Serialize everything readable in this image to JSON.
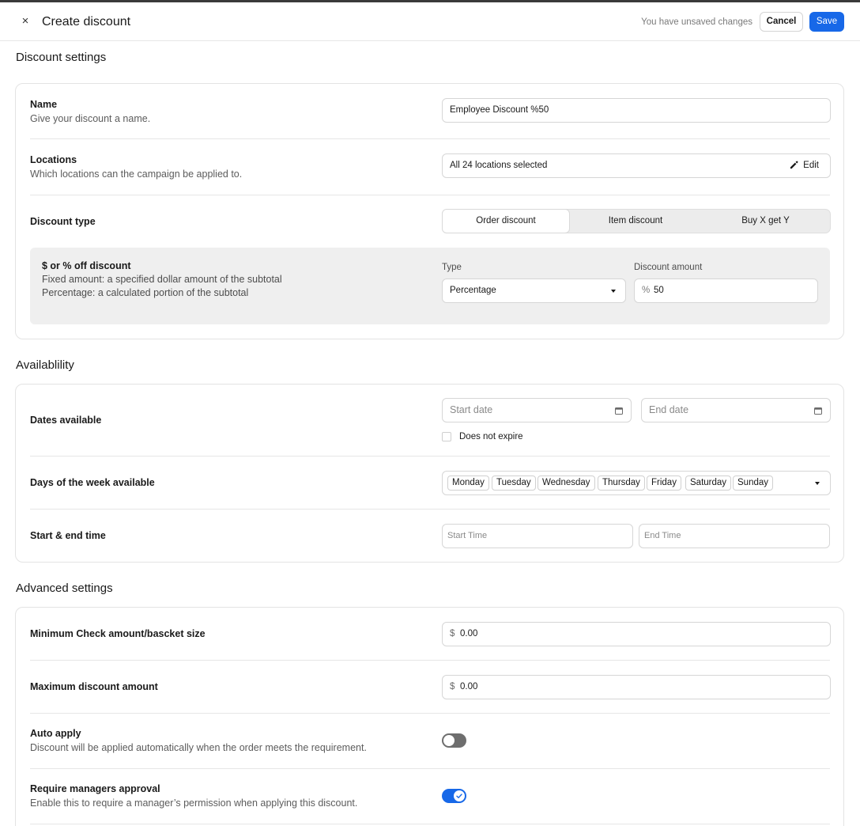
{
  "header": {
    "close_glyph": "×",
    "title": "Create discount",
    "unsaved": "You have unsaved changes",
    "cancel_label": "Cancel",
    "save_label": "Save"
  },
  "colors": {
    "accent": "#1768e8",
    "toggle_off": "#6e6e6e",
    "subpanel_bg": "#efefef"
  },
  "discount_settings": {
    "title": "Discount settings",
    "name": {
      "label": "Name",
      "description": "Give your discount a name.",
      "value": "Employee Discount %50"
    },
    "locations": {
      "label": "Locations",
      "description": "Which locations can the campaign be applied to.",
      "value": "All 24 locations selected",
      "edit_label": "Edit"
    },
    "discount_type": {
      "label": "Discount type",
      "options": [
        "Order discount",
        "Item discount",
        "Buy X get Y"
      ],
      "selected": "Order discount"
    },
    "off_panel": {
      "title": "$ or % off discount",
      "line1": "Fixed amount: a specified dollar amount of the subtotal",
      "line2": "Percentage: a calculated portion of the subtotal",
      "type_label": "Type",
      "type_value": "Percentage",
      "amount_label": "Discount amount",
      "amount_prefix": "%",
      "amount_value": "50"
    }
  },
  "availability": {
    "title": "Availablility",
    "dates": {
      "label": "Dates available",
      "start_placeholder": "Start date",
      "end_placeholder": "End date",
      "no_expire_label": "Does not expire",
      "no_expire_checked": false
    },
    "days": {
      "label": "Days of the week available",
      "selected": [
        "Monday",
        "Tuesday",
        "Wednesday",
        "Thursday",
        "Friday",
        "Saturday",
        "Sunday"
      ]
    },
    "times": {
      "label": "Start & end time",
      "start_placeholder": "Start Time",
      "end_placeholder": "End Time"
    }
  },
  "advanced": {
    "title": "Advanced settings",
    "min_check": {
      "label": "Minimum Check amount/bascket size",
      "prefix": "$",
      "value": "0.00"
    },
    "max_discount": {
      "label": "Maximum discount amount",
      "prefix": "$",
      "value": "0.00"
    },
    "auto_apply": {
      "label": "Auto apply",
      "description": "Discount will be applied automatically when the order meets the requirement.",
      "enabled": false
    },
    "manager_approval": {
      "label": "Require managers approval",
      "description": "Enable this to require a manager’s permission when applying this discount.",
      "enabled": true
    }
  }
}
